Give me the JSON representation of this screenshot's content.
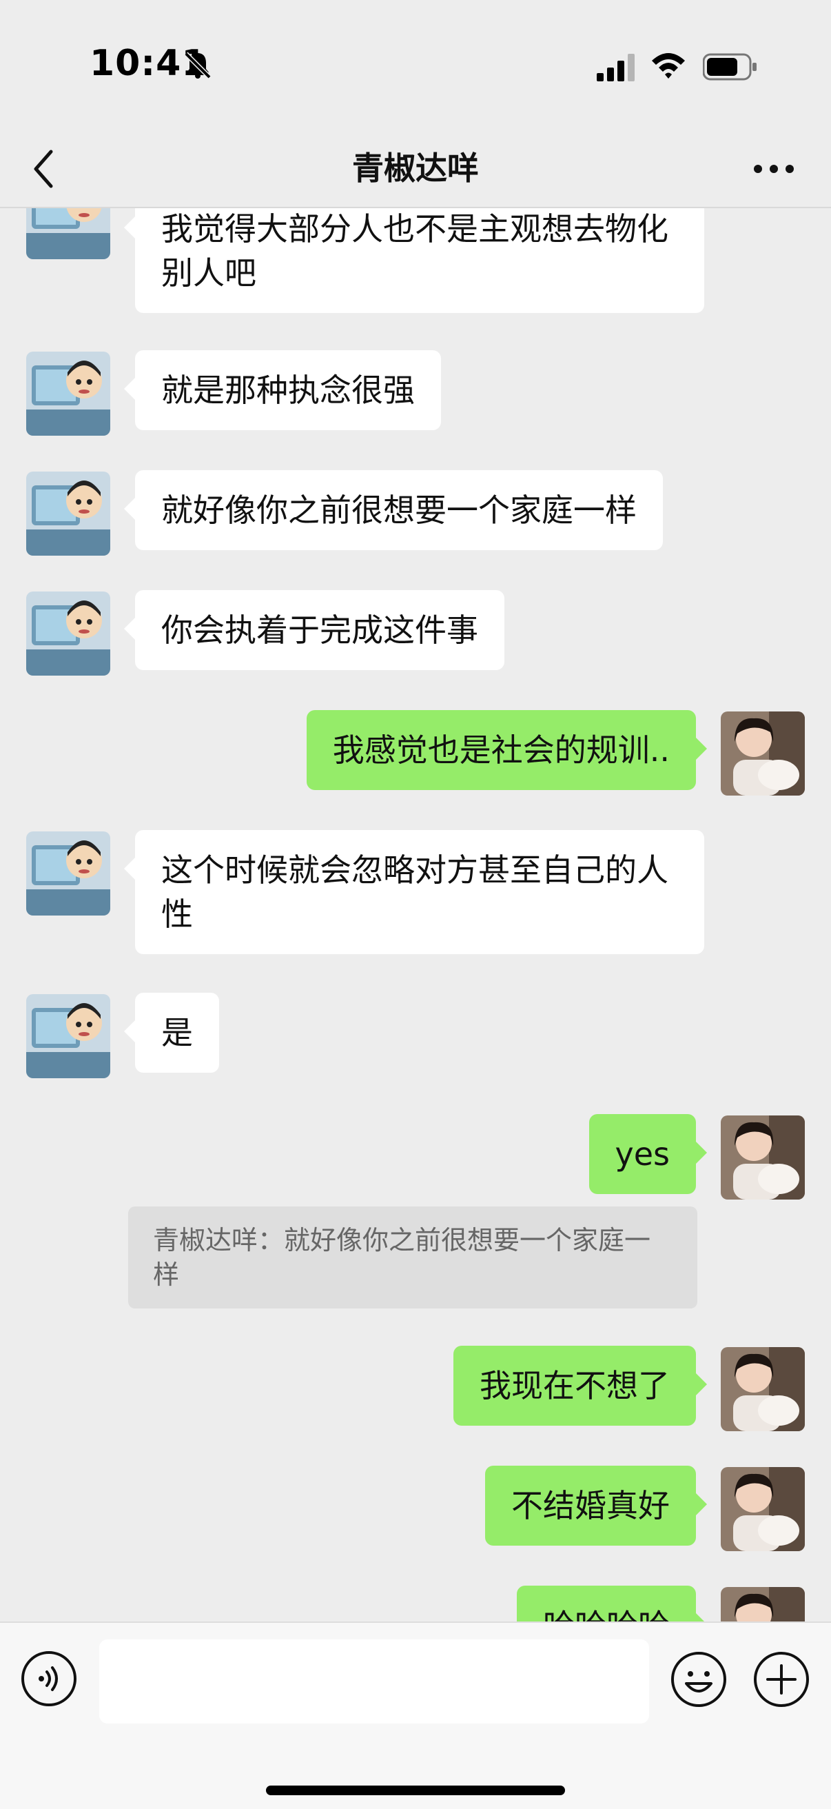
{
  "status_bar": {
    "time": "10:41",
    "icons": [
      "bell-muted-icon",
      "signal-icon",
      "wifi-icon",
      "battery-icon"
    ]
  },
  "nav": {
    "title": "青椒达咩",
    "back_icon": "chevron-left-icon",
    "more_icon": "more-dots-icon"
  },
  "messages": [
    {
      "side": "in",
      "text": "我觉得大部分人也不是主观想去物化别人吧"
    },
    {
      "side": "in",
      "text": "就是那种执念很强"
    },
    {
      "side": "in",
      "text": "就好像你之前很想要一个家庭一样"
    },
    {
      "side": "in",
      "text": "你会执着于完成这件事"
    },
    {
      "side": "out",
      "text": "我感觉也是社会的规训.."
    },
    {
      "side": "in",
      "text": "这个时候就会忽略对方甚至自己的人性"
    },
    {
      "side": "in",
      "text": "是"
    },
    {
      "side": "out",
      "text": "yes",
      "quote": "青椒达咩：就好像你之前很想要一个家庭一样"
    },
    {
      "side": "out",
      "text": "我现在不想了"
    },
    {
      "side": "out",
      "text": "不结婚真好"
    },
    {
      "side": "out",
      "text": "哈哈哈哈"
    }
  ],
  "input_bar": {
    "icons": [
      "voice-icon",
      "emoji-icon",
      "plus-icon"
    ],
    "value": ""
  },
  "colors": {
    "background": "#EDEDED",
    "outgoing_bubble": "#95EC69",
    "incoming_bubble": "#FFFFFF"
  }
}
